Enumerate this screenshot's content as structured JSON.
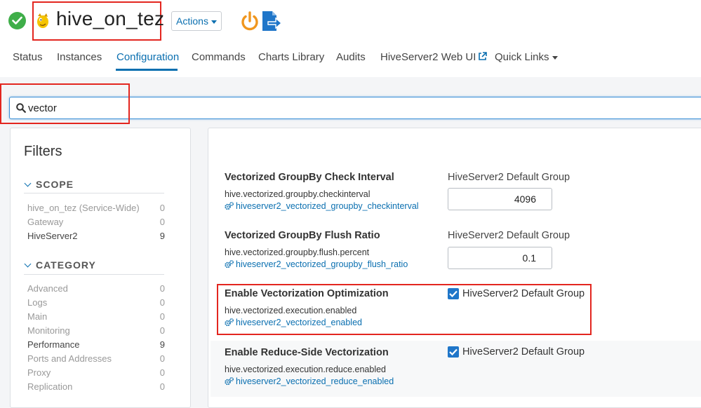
{
  "header": {
    "title": "hive_on_tez",
    "actions_label": "Actions"
  },
  "tabs": [
    {
      "label": "Status"
    },
    {
      "label": "Instances"
    },
    {
      "label": "Configuration"
    },
    {
      "label": "Commands"
    },
    {
      "label": "Charts Library"
    },
    {
      "label": "Audits"
    },
    {
      "label": "HiveServer2 Web UI"
    },
    {
      "label": "Quick Links"
    }
  ],
  "search": {
    "value": "vector"
  },
  "filters": {
    "title": "Filters",
    "scope": {
      "heading": "SCOPE",
      "items": [
        {
          "label": "hive_on_tez (Service-Wide)",
          "count": "0"
        },
        {
          "label": "Gateway",
          "count": "0"
        },
        {
          "label": "HiveServer2",
          "count": "9"
        }
      ]
    },
    "category": {
      "heading": "CATEGORY",
      "items": [
        {
          "label": "Advanced",
          "count": "0"
        },
        {
          "label": "Logs",
          "count": "0"
        },
        {
          "label": "Main",
          "count": "0"
        },
        {
          "label": "Monitoring",
          "count": "0"
        },
        {
          "label": "Performance",
          "count": "9"
        },
        {
          "label": "Ports and Addresses",
          "count": "0"
        },
        {
          "label": "Proxy",
          "count": "0"
        },
        {
          "label": "Replication",
          "count": "0"
        }
      ]
    }
  },
  "properties": [
    {
      "name": "Vectorized GroupBy Check Interval",
      "key": "hive.vectorized.groupby.checkinterval",
      "link": "hiveserver2_vectorized_groupby_checkinterval",
      "group": "HiveServer2 Default Group",
      "value": "4096"
    },
    {
      "name": "Vectorized GroupBy Flush Ratio",
      "key": "hive.vectorized.groupby.flush.percent",
      "link": "hiveserver2_vectorized_groupby_flush_ratio",
      "group": "HiveServer2 Default Group",
      "value": "0.1"
    },
    {
      "name": "Enable Vectorization Optimization",
      "key": "hive.vectorized.execution.enabled",
      "link": "hiveserver2_vectorized_enabled",
      "group": "HiveServer2 Default Group",
      "checked": true
    },
    {
      "name": "Enable Reduce-Side Vectorization",
      "key": "hive.vectorized.execution.reduce.enabled",
      "link": "hiveserver2_vectorized_reduce_enabled",
      "group": "HiveServer2 Default Group",
      "checked": true
    }
  ],
  "colors": {
    "accent": "#0a6fb0",
    "highlight": "#e3261f",
    "success": "#3fae49",
    "checkbox": "#1f76c9"
  }
}
